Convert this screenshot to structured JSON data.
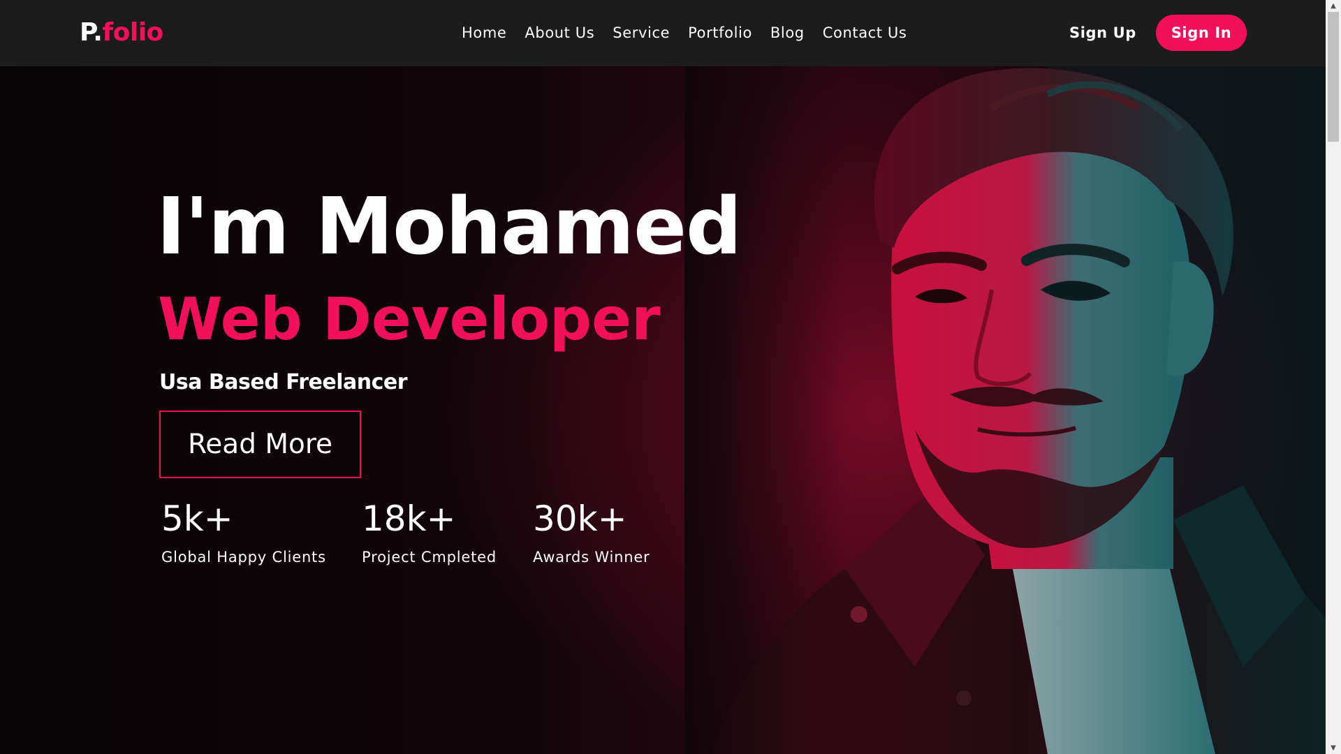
{
  "brand": {
    "logo_prefix": "P.",
    "logo_suffix": "folio",
    "accent_color": "#f2105a"
  },
  "nav": {
    "links": [
      {
        "label": "Home"
      },
      {
        "label": "About Us"
      },
      {
        "label": "Service"
      },
      {
        "label": "Portfolio"
      },
      {
        "label": "Blog"
      },
      {
        "label": "Contact Us"
      }
    ],
    "sign_up": "Sign Up",
    "sign_in": "Sign In"
  },
  "hero": {
    "title": "I'm Mohamed",
    "role": "Web Developer",
    "tagline": "Usa Based Freelancer",
    "cta": "Read More",
    "stats": [
      {
        "value": "5k+",
        "label": "Global Happy Clients"
      },
      {
        "value": "18k+",
        "label": "Project Cmpleted"
      },
      {
        "value": "30k+",
        "label": "Awards Winner"
      }
    ],
    "image": "portrait-photo"
  },
  "scrollbar": {
    "up_icon": "chevron-up-icon",
    "down_icon": "chevron-down-icon"
  }
}
